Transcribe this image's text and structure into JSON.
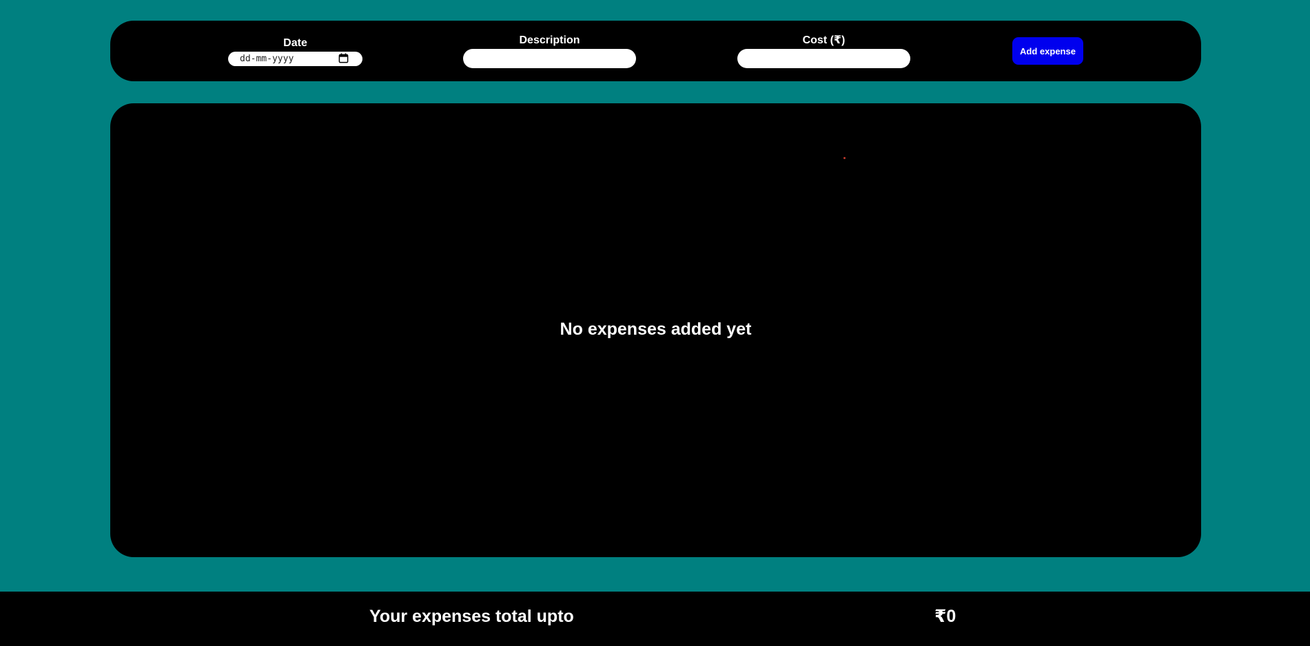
{
  "form": {
    "date": {
      "label": "Date",
      "placeholder": "dd-mm-yyyy",
      "icon": "calendar-icon"
    },
    "description": {
      "label": "Description",
      "value": ""
    },
    "cost": {
      "label": "Cost (₹)",
      "value": ""
    },
    "add_button_label": "Add expense"
  },
  "list": {
    "empty_message": "No expenses added yet"
  },
  "footer": {
    "total_label": "Your expenses total upto",
    "total_value": "₹0"
  },
  "colors": {
    "background": "#008080",
    "card": "#000000",
    "button": "#0000ee",
    "text": "#ffffff"
  }
}
